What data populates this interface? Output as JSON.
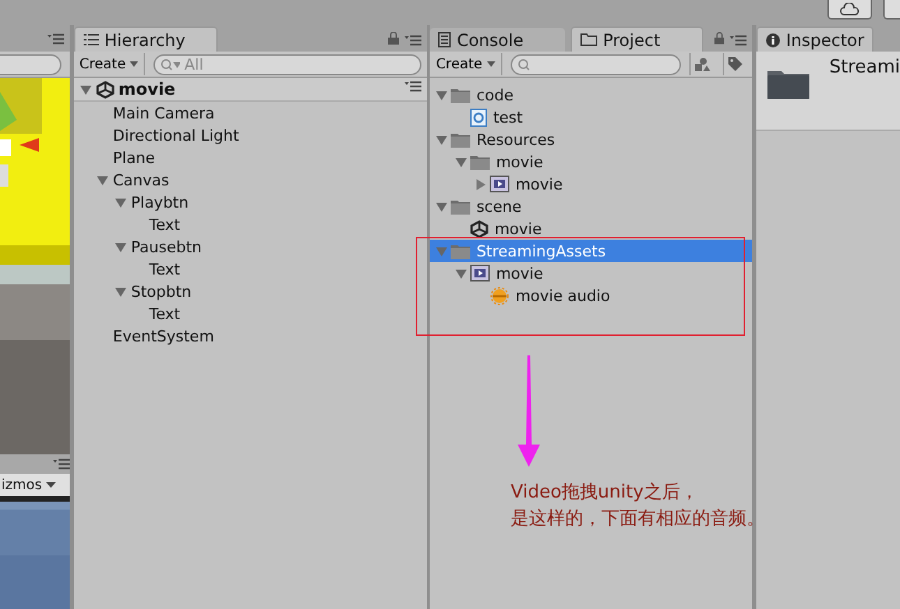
{
  "scene_panel": {
    "toolbar_text": "izmos"
  },
  "hierarchy": {
    "tab": {
      "label": "Hierarchy",
      "selected": true
    },
    "create": "Create",
    "search": {
      "placeholder": "All"
    },
    "scene": {
      "name": "movie",
      "expanded": true
    },
    "items": [
      {
        "name": "Main Camera"
      },
      {
        "name": "Directional Light"
      },
      {
        "name": "Plane"
      },
      {
        "name": "Canvas",
        "expanded": true,
        "children": [
          {
            "name": "Playbtn",
            "expanded": true,
            "children": [
              {
                "name": "Text"
              }
            ]
          },
          {
            "name": "Pausebtn",
            "expanded": true,
            "children": [
              {
                "name": "Text"
              }
            ]
          },
          {
            "name": "Stopbtn",
            "expanded": true,
            "children": [
              {
                "name": "Text"
              }
            ]
          }
        ]
      },
      {
        "name": "EventSystem"
      }
    ]
  },
  "project": {
    "tabs": [
      {
        "label": "Console",
        "selected": false
      },
      {
        "label": "Project",
        "selected": true
      }
    ],
    "create": "Create",
    "items": [
      {
        "name": "code",
        "kind": "folder",
        "expanded": true,
        "selected": false,
        "children": [
          {
            "name": "test",
            "kind": "script",
            "selected": false
          }
        ]
      },
      {
        "name": "Resources",
        "kind": "folder",
        "expanded": true,
        "selected": false,
        "children": [
          {
            "name": "movie",
            "kind": "folder",
            "expanded": true,
            "selected": false,
            "children": [
              {
                "name": "movie",
                "kind": "video",
                "expanded": false,
                "selected": false
              }
            ]
          }
        ]
      },
      {
        "name": "scene",
        "kind": "folder",
        "expanded": true,
        "selected": false,
        "children": [
          {
            "name": "movie",
            "kind": "scene",
            "selected": false
          }
        ]
      },
      {
        "name": "StreamingAssets",
        "kind": "folder",
        "expanded": true,
        "selected": true,
        "children": [
          {
            "name": "movie",
            "kind": "video",
            "expanded": true,
            "selected": false,
            "children": [
              {
                "name": "movie audio",
                "kind": "audio",
                "selected": false
              }
            ]
          }
        ]
      }
    ]
  },
  "inspector": {
    "tab": {
      "label": "Inspector",
      "selected": true
    },
    "title": "Streami"
  },
  "annotation": {
    "lines": [
      "Video拖拽unity之后，",
      "是这样的，下面有相应的音频。"
    ]
  }
}
